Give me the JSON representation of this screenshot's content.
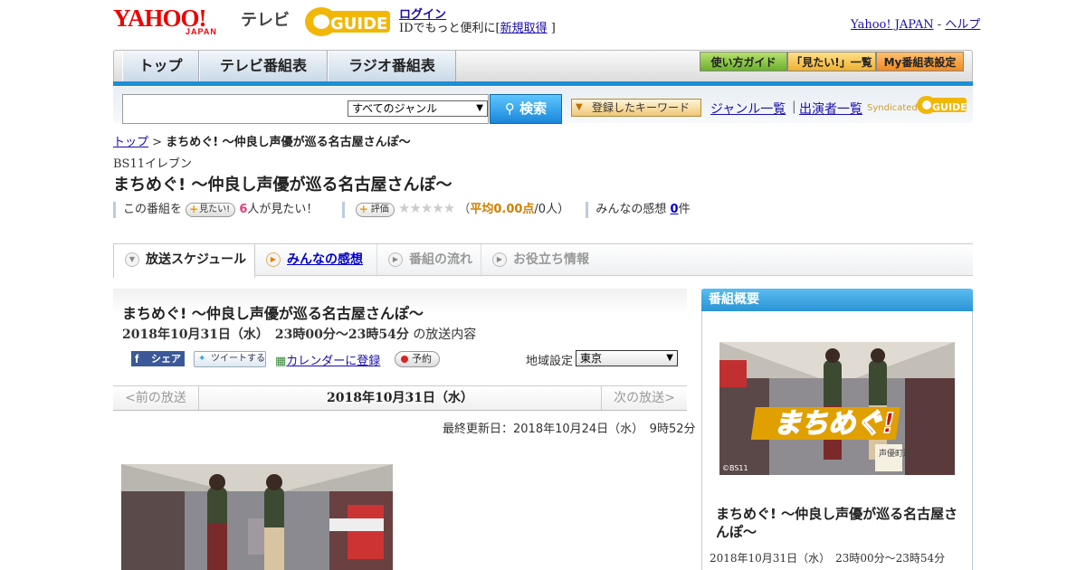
{
  "header": {
    "logo_text": "YAHOO!",
    "logo_sub": "JAPAN",
    "service": "テレビ",
    "gguide_logo": "GUIDE",
    "login_label": "ログイン",
    "login_sub": "IDでもっと便利に[",
    "register_label": "新規取得",
    "login_sub_end": "]",
    "yahoo_link": "Yahoo! JAPAN",
    "dash": "-",
    "help_link": "ヘルプ"
  },
  "nav": {
    "tabs": [
      "トップ",
      "テレビ番組表",
      "ラジオ番組表"
    ],
    "utility": [
      "使い方ガイド",
      "「見たい!」一覧",
      "My番組表設定"
    ]
  },
  "search": {
    "placeholder": "",
    "genre": "すべてのジャンル",
    "button": "検索",
    "keyword_button": "登録したキーワード",
    "genre_link": "ジャンル一覧",
    "separator": "|",
    "cast_link": "出演者一覧",
    "syndicated": "Syndicated",
    "syndicated_logo": "GUIDE"
  },
  "breadcrumb": {
    "home": "トップ",
    "sep": ">",
    "current": "まちめぐ! ～仲良し声優が巡る名古屋さんぽ～"
  },
  "program": {
    "channel": "BS11イレブン",
    "title": "まちめぐ! ～仲良し声優が巡る名古屋さんぽ～",
    "watch_prefix": "この番組を",
    "watch_button": "見たい!",
    "watch_count": "6",
    "watch_suffix": "人が見たい！",
    "rate_button": "評価",
    "stars": "★★★★★",
    "avg_open": "（",
    "avg_label": "平均0.00点",
    "avg_count": "/0人）",
    "impressions_label": "みんなの感想",
    "impressions_count": "0",
    "impressions_unit": "件"
  },
  "tabs": [
    {
      "label": "放送スケジュール",
      "active": true
    },
    {
      "label": "みんなの感想",
      "link": true
    },
    {
      "label": "番組の流れ",
      "disabled": true
    },
    {
      "label": "お役立ち情報",
      "disabled": true
    }
  ],
  "schedule": {
    "title": "まちめぐ! ～仲良し声優が巡る名古屋さんぽ～",
    "date_time": "2018年10月31日（水）　23時00分～23時54分",
    "suffix": "の放送内容",
    "share": "シェア",
    "tweet": "ツイートする",
    "calendar": "カレンダーに登録",
    "reserve": "予約",
    "region_label": "地域設定",
    "region": "東京",
    "prev": "<前の放送",
    "current_date": "2018年10月31日（水）",
    "next": "次の放送>",
    "updated": "最終更新日：2018年10月24日（水）　9時52分"
  },
  "side": {
    "header": "番組概要",
    "logo_text": "まちめぐ!",
    "logo_tag": "声優町巡",
    "copyright": "©BS11",
    "title": "まちめぐ! ～仲良し声優が巡る名古屋さんぽ～",
    "time": "2018年10月31日（水）　23時00分～23時54分"
  },
  "colors": {
    "accent": "#1a8fd6",
    "brand_red": "#ee0000",
    "gguide_yellow": "#f2b705"
  }
}
